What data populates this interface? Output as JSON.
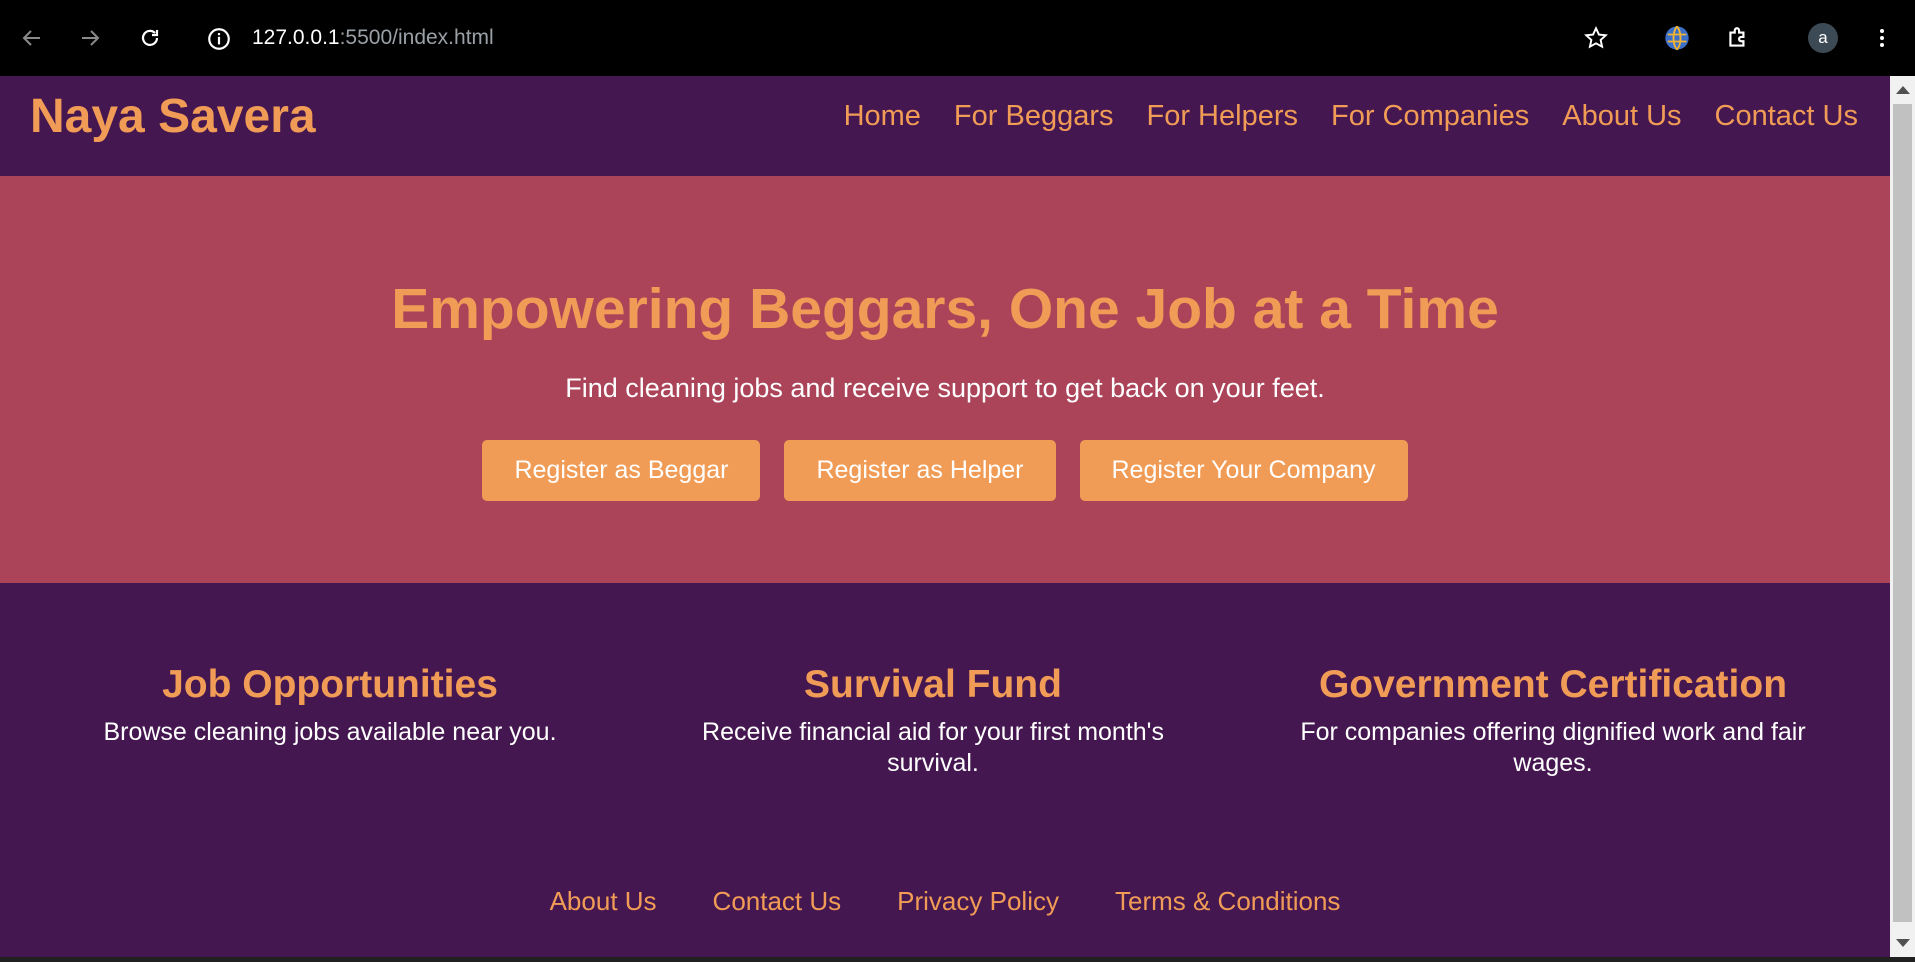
{
  "browser": {
    "url_host": "127.0.0.1",
    "url_rest": ":5500/index.html",
    "profile_initial": "a"
  },
  "site": {
    "logo": "Naya Savera",
    "nav": [
      "Home",
      "For Beggars",
      "For Helpers",
      "For Companies",
      "About Us",
      "Contact Us"
    ]
  },
  "hero": {
    "title": "Empowering Beggars, One Job at a Time",
    "subtitle": "Find cleaning jobs and receive support to get back on your feet.",
    "buttons": [
      "Register as Beggar",
      "Register as Helper",
      "Register Your Company"
    ]
  },
  "features": [
    {
      "title": "Job Opportunities",
      "text": "Browse cleaning jobs available near you."
    },
    {
      "title": "Survival Fund",
      "text": "Receive financial aid for your first month's survival."
    },
    {
      "title": "Government Certification",
      "text": "For companies offering dignified work and fair wages."
    }
  ],
  "footer": {
    "links": [
      "About Us",
      "Contact Us",
      "Privacy Policy",
      "Terms & Conditions"
    ]
  },
  "colors": {
    "header_bg": "#451750",
    "hero_bg": "#ab4459",
    "accent": "#f19c56",
    "text_light": "#ffffff"
  },
  "icons": [
    "back-arrow-icon",
    "forward-arrow-icon",
    "reload-icon",
    "site-info-icon",
    "bookmark-star-icon",
    "extension-globe-icon",
    "extensions-puzzle-icon",
    "profile-avatar-icon",
    "more-menu-icon"
  ]
}
